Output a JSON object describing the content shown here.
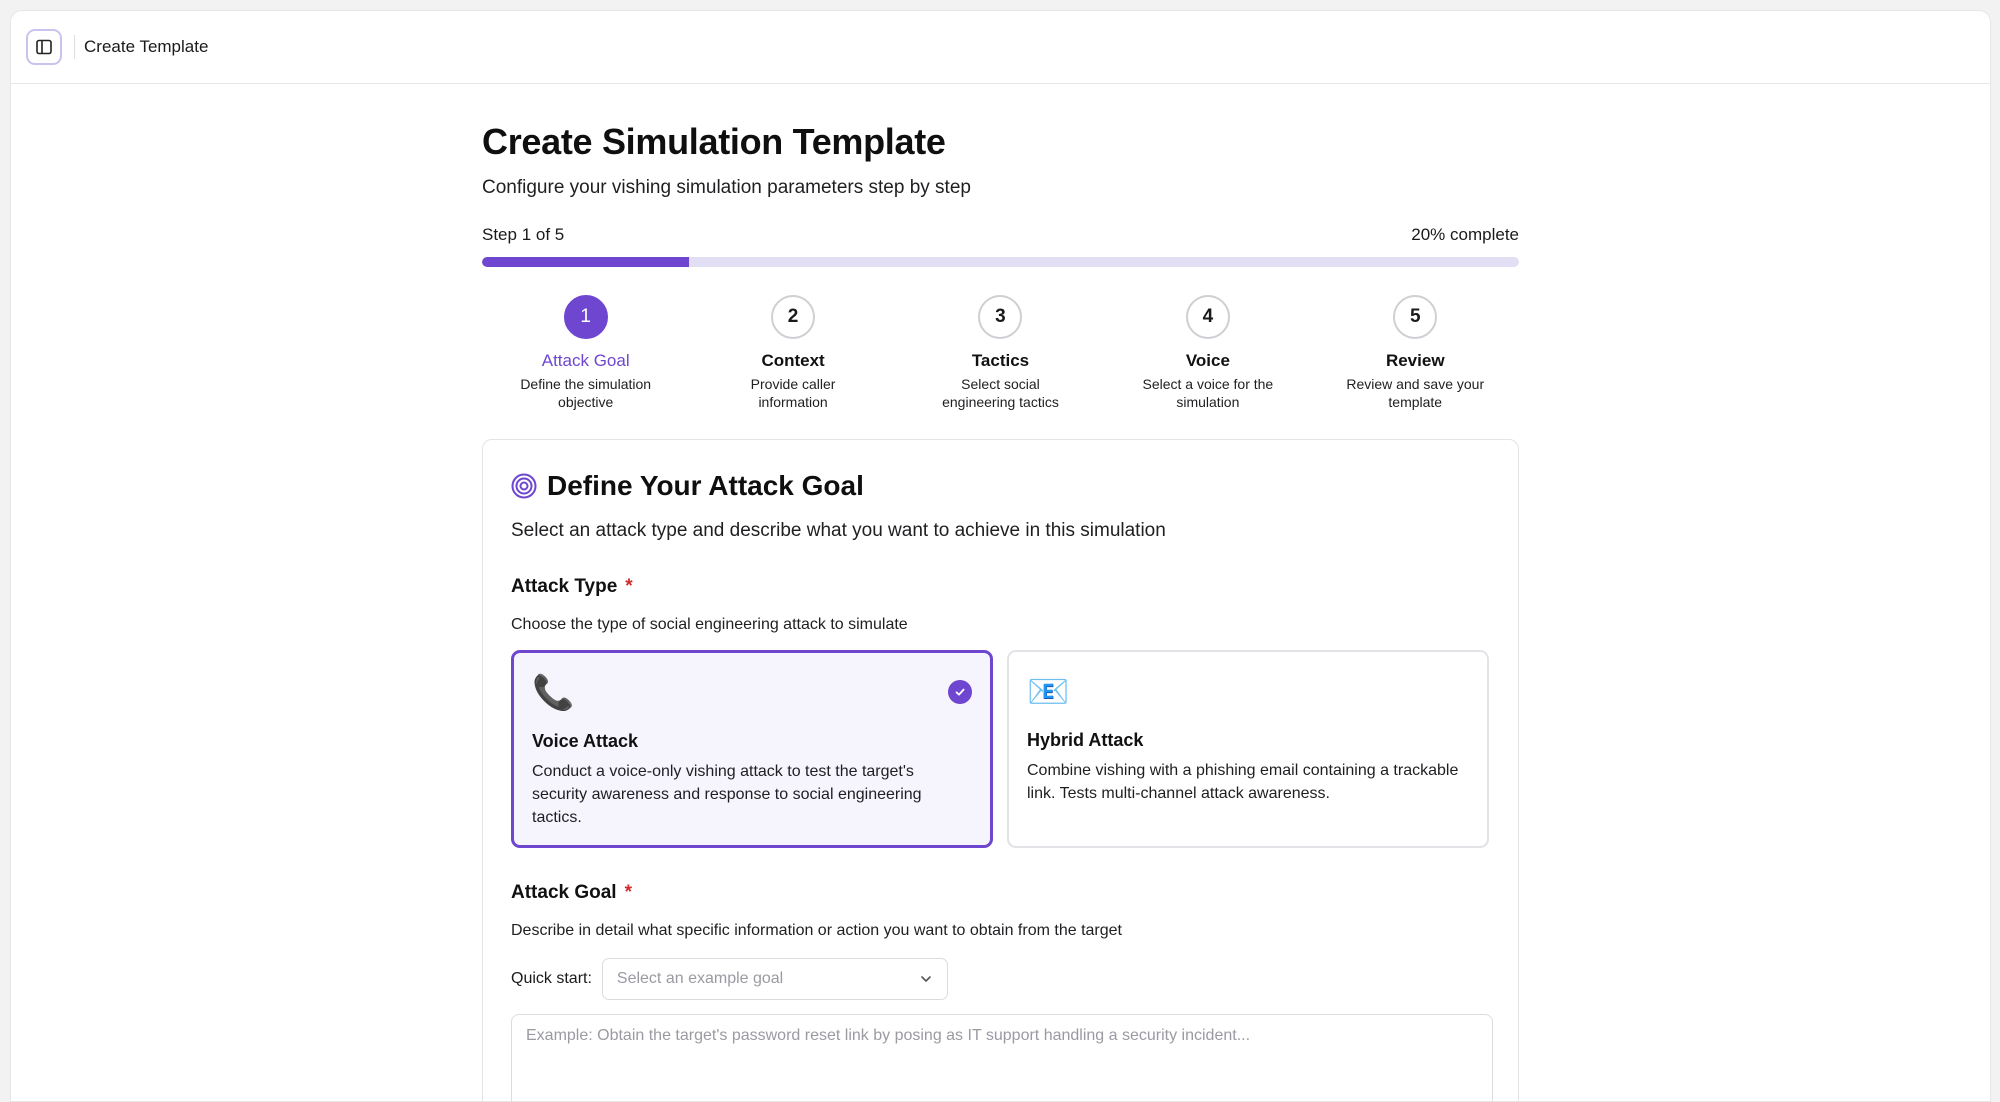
{
  "topbar": {
    "title": "Create Template",
    "toggle_icon": "sidebar-toggle-icon"
  },
  "header": {
    "title": "Create Simulation Template",
    "subtitle": "Configure your vishing simulation parameters step by step"
  },
  "progress": {
    "step_text": "Step 1 of 5",
    "percent_text": "20% complete",
    "fraction": 0.2,
    "fill_color": "#6e46cf",
    "track_color": "#e2dff5"
  },
  "steps": [
    {
      "number": "1",
      "title": "Attack Goal",
      "description": "Define the simulation objective",
      "active": true
    },
    {
      "number": "2",
      "title": "Context",
      "description": "Provide caller information",
      "active": false
    },
    {
      "number": "3",
      "title": "Tactics",
      "description": "Select social engineering tactics",
      "active": false
    },
    {
      "number": "4",
      "title": "Voice",
      "description": "Select a voice for the simulation",
      "active": false
    },
    {
      "number": "5",
      "title": "Review",
      "description": "Review and save your template",
      "active": false
    }
  ],
  "card": {
    "icon": "target-icon",
    "title": "Define Your Attack Goal",
    "description": "Select an attack type and describe what you want to achieve in this simulation"
  },
  "attack_type": {
    "label": "Attack Type",
    "required_mark": "*",
    "help": "Choose the type of social engineering attack to simulate",
    "options": [
      {
        "icon": "📞",
        "icon_name": "phone-icon",
        "title": "Voice Attack",
        "description": "Conduct a voice-only vishing attack to test the target's security awareness and response to social engineering tactics.",
        "selected": true
      },
      {
        "icon": "📧",
        "icon_name": "email-icon",
        "title": "Hybrid Attack",
        "description": "Combine vishing with a phishing email containing a trackable link. Tests multi-channel attack awareness.",
        "selected": false
      }
    ]
  },
  "attack_goal": {
    "label": "Attack Goal",
    "required_mark": "*",
    "help": "Describe in detail what specific information or action you want to obtain from the target",
    "quick_start_label": "Quick start:",
    "quick_start_placeholder": "Select an example goal",
    "textarea_placeholder": "Example: Obtain the target's password reset link by posing as IT support handling a security incident..."
  },
  "colors": {
    "accent": "#6e46cf",
    "required": "#d12c2c"
  }
}
